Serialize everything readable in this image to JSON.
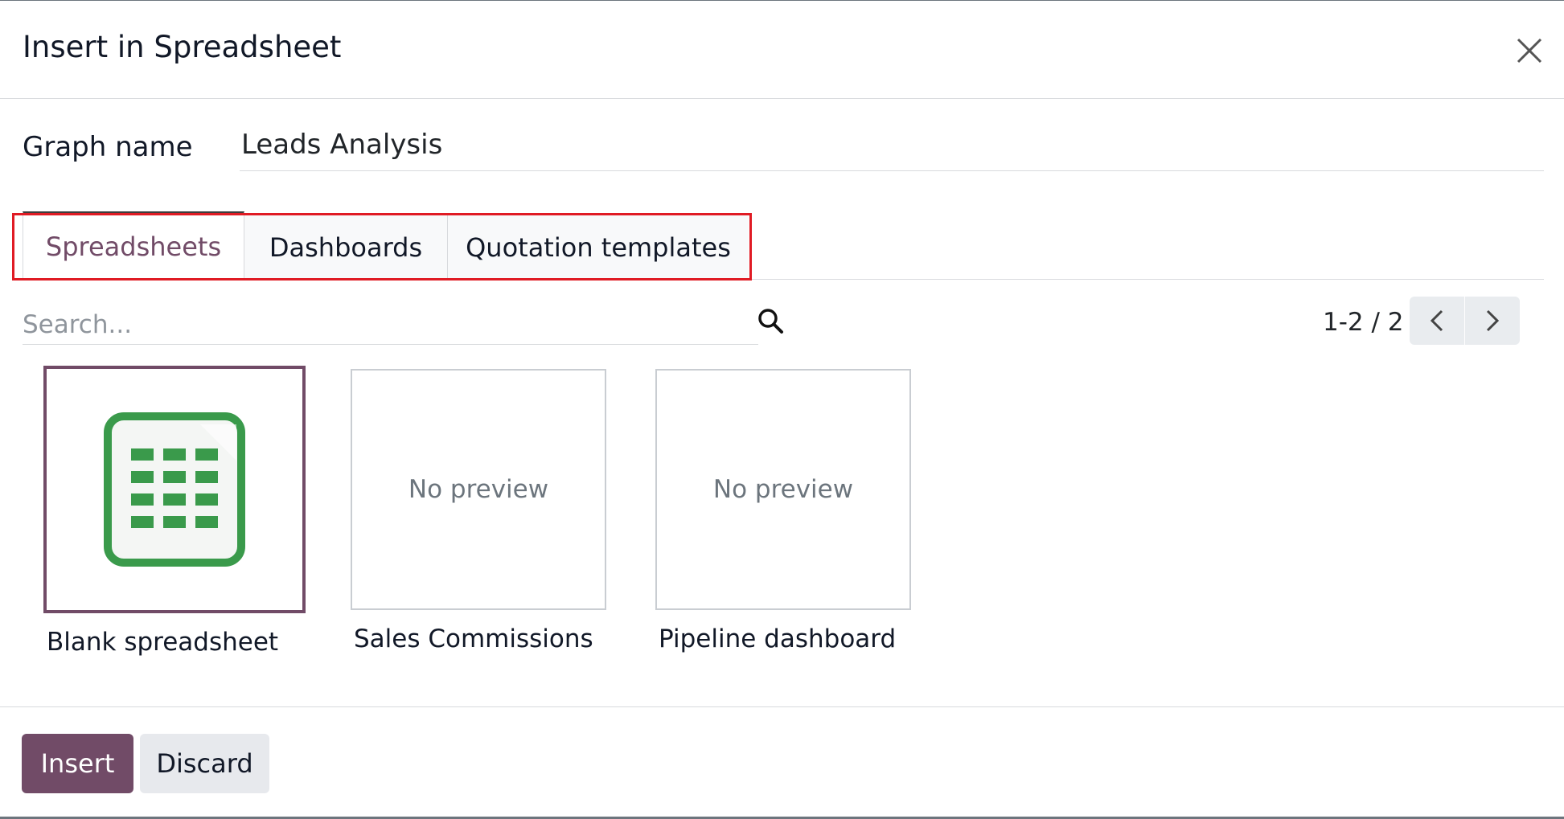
{
  "dialog": {
    "title": "Insert in Spreadsheet",
    "close_icon": "close-icon"
  },
  "graph_name": {
    "label": "Graph name",
    "value": "Leads Analysis"
  },
  "tabs": [
    {
      "label": "Spreadsheets",
      "active": true
    },
    {
      "label": "Dashboards",
      "active": false
    },
    {
      "label": "Quotation templates",
      "active": false
    }
  ],
  "search": {
    "placeholder": "Search...",
    "icon": "search-icon"
  },
  "pager": {
    "value": "1-2 / 2",
    "prev_icon": "chevron-left-icon",
    "next_icon": "chevron-right-icon"
  },
  "cards": [
    {
      "name": "Blank spreadsheet",
      "preview": "spreadsheet-icon",
      "selected": true
    },
    {
      "name": "Sales Commissions",
      "preview_text": "No preview",
      "selected": false
    },
    {
      "name": "Pipeline dashboard",
      "preview_text": "No preview",
      "selected": false
    }
  ],
  "footer": {
    "insert_label": "Insert",
    "discard_label": "Discard"
  },
  "colors": {
    "accent": "#714b67",
    "highlight": "#e01b24",
    "spreadsheet_green": "#3a9a4b"
  }
}
